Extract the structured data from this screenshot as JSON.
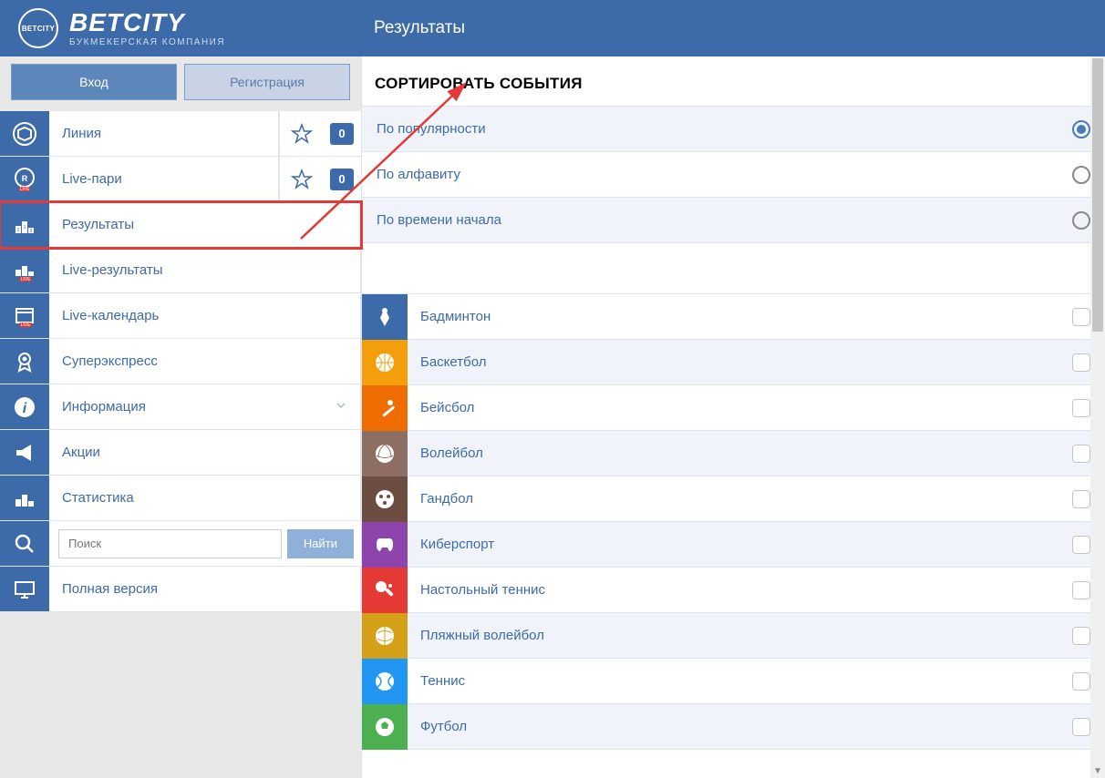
{
  "header": {
    "logo_badge": "BETCITY",
    "logo_name": "BETCITY",
    "logo_tagline": "БУКМЕКЕРСКАЯ КОМПАНИЯ",
    "page_title": "Результаты"
  },
  "auth": {
    "login": "Вход",
    "register": "Регистрация"
  },
  "nav": [
    {
      "id": "line",
      "label": "Линия",
      "count": "0",
      "has_star": true
    },
    {
      "id": "live",
      "label": "Live-пари",
      "count": "0",
      "has_star": true
    },
    {
      "id": "results",
      "label": "Результаты",
      "highlighted": true
    },
    {
      "id": "live-results",
      "label": "Live-результаты"
    },
    {
      "id": "live-calendar",
      "label": "Live-календарь"
    },
    {
      "id": "superexpress",
      "label": "Суперэкспресс"
    },
    {
      "id": "info",
      "label": "Информация",
      "has_chevron": true
    },
    {
      "id": "promo",
      "label": "Акции"
    },
    {
      "id": "stats",
      "label": "Статистика"
    },
    {
      "id": "search",
      "is_search": true
    },
    {
      "id": "fullversion",
      "label": "Полная версия"
    }
  ],
  "search": {
    "placeholder": "Поиск",
    "button": "Найти"
  },
  "sort": {
    "heading": "СОРТИРОВАТЬ СОБЫТИЯ",
    "options": [
      {
        "label": "По популярности",
        "selected": true
      },
      {
        "label": "По алфавиту",
        "selected": false
      },
      {
        "label": "По времени начала",
        "selected": false
      }
    ]
  },
  "sports": [
    {
      "label": "Бадминтон",
      "color": "#3d6aa8",
      "icon": "shuttlecock"
    },
    {
      "label": "Баскетбол",
      "color": "#f59e0b",
      "icon": "basketball"
    },
    {
      "label": "Бейсбол",
      "color": "#ef6c00",
      "icon": "baseball"
    },
    {
      "label": "Волейбол",
      "color": "#8d6e63",
      "icon": "volleyball"
    },
    {
      "label": "Гандбол",
      "color": "#6d4c41",
      "icon": "handball"
    },
    {
      "label": "Киберспорт",
      "color": "#8e44ad",
      "icon": "esports"
    },
    {
      "label": "Настольный теннис",
      "color": "#e53935",
      "icon": "tabletennis"
    },
    {
      "label": "Пляжный волейбол",
      "color": "#d4a017",
      "icon": "beachvolley"
    },
    {
      "label": "Теннис",
      "color": "#2196f3",
      "icon": "tennis"
    },
    {
      "label": "Футбол",
      "color": "#4caf50",
      "icon": "football"
    }
  ]
}
